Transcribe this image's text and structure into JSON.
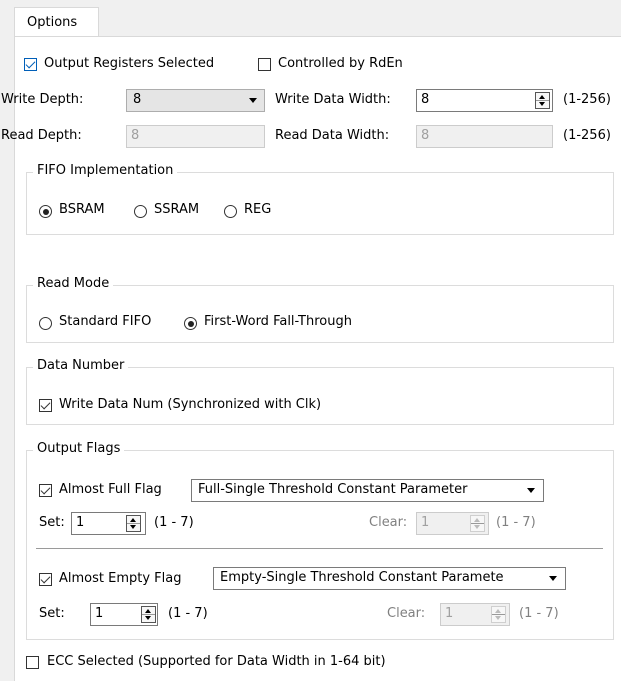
{
  "tab": {
    "label": "Options"
  },
  "output_registers": {
    "label": "Output Registers Selected",
    "checked": true
  },
  "controlled_by_rden": {
    "label": "Controlled by RdEn",
    "checked": false
  },
  "write_depth": {
    "label": "Write Depth:",
    "value": "8"
  },
  "write_data_width": {
    "label": "Write Data Width:",
    "value": "8",
    "range": "(1-256)"
  },
  "read_depth": {
    "label": "Read Depth:",
    "value": "8"
  },
  "read_data_width": {
    "label": "Read Data Width:",
    "value": "8",
    "range": "(1-256)"
  },
  "fifo_impl": {
    "title": "FIFO Implementation",
    "options": [
      "BSRAM",
      "SSRAM",
      "REG"
    ],
    "selected": "BSRAM"
  },
  "read_mode": {
    "title": "Read Mode",
    "options": [
      "Standard FIFO",
      "First-Word Fall-Through"
    ],
    "selected": "First-Word Fall-Through"
  },
  "data_number": {
    "title": "Data Number",
    "write_data_num": {
      "label": "Write Data Num (Synchronized with Clk)",
      "checked": true
    }
  },
  "output_flags": {
    "title": "Output Flags",
    "almost_full": {
      "label": "Almost Full Flag",
      "checked": true,
      "mode": "Full-Single Threshold Constant Parameter",
      "set_label": "Set:",
      "set_value": "1",
      "set_range": "(1 - 7)",
      "clear_label": "Clear:",
      "clear_value": "1",
      "clear_range": "(1 - 7)"
    },
    "almost_empty": {
      "label": "Almost Empty Flag",
      "checked": true,
      "mode": "Empty-Single Threshold Constant Parametе",
      "set_label": "Set:",
      "set_value": "1",
      "set_range": "(1 - 7)",
      "clear_label": "Clear:",
      "clear_value": "1",
      "clear_range": "(1 - 7)"
    }
  },
  "ecc": {
    "label": "ECC Selected (Supported for Data Width in 1-64 bit)",
    "checked": false
  },
  "colors": {
    "accent": "#005fb8",
    "panel": "#ffffff",
    "background": "#f0f0f0"
  }
}
